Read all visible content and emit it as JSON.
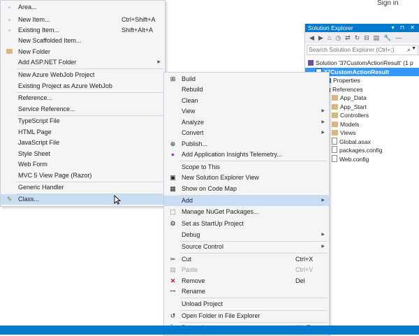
{
  "header": {
    "sign_in": "Sign in"
  },
  "solution_explorer": {
    "title": "Solution Explorer",
    "title_buttons": "▾ ⊓ ✕",
    "search_placeholder": "Search Solution Explorer (Ctrl+;)",
    "solution_label": "Solution '37CustomActionResult' (1 p",
    "project_label": "37CustomActionResult",
    "nodes": [
      "Properties",
      "References",
      "App_Data",
      "App_Start",
      "Controllers",
      "Models",
      "Views",
      "Global.asax",
      "packages.config",
      "Web.config"
    ]
  },
  "add_menu": {
    "items": [
      {
        "label": "Area...",
        "shortcut": ""
      },
      {
        "label": "New Item...",
        "shortcut": "Ctrl+Shift+A"
      },
      {
        "label": "Existing Item...",
        "shortcut": "Shift+Alt+A"
      },
      {
        "label": "New Scaffolded Item...",
        "shortcut": ""
      },
      {
        "label": "New Folder",
        "shortcut": ""
      },
      {
        "label": "Add ASP.NET Folder",
        "shortcut": ""
      },
      {
        "label": "New Azure WebJob Project",
        "shortcut": ""
      },
      {
        "label": "Existing Project as Azure WebJob",
        "shortcut": ""
      },
      {
        "label": "Reference...",
        "shortcut": ""
      },
      {
        "label": "Service Reference...",
        "shortcut": ""
      },
      {
        "label": "TypeScript File",
        "shortcut": ""
      },
      {
        "label": "HTML Page",
        "shortcut": ""
      },
      {
        "label": "JavaScript File",
        "shortcut": ""
      },
      {
        "label": "Style Sheet",
        "shortcut": ""
      },
      {
        "label": "Web Form",
        "shortcut": ""
      },
      {
        "label": "MVC 5 View Page (Razor)",
        "shortcut": ""
      },
      {
        "label": "Generic Handler",
        "shortcut": ""
      },
      {
        "label": "Class...",
        "shortcut": ""
      }
    ]
  },
  "context_menu": {
    "items": [
      {
        "label": "Build",
        "shortcut": ""
      },
      {
        "label": "Rebuild",
        "shortcut": ""
      },
      {
        "label": "Clean",
        "shortcut": ""
      },
      {
        "label": "View",
        "shortcut": ""
      },
      {
        "label": "Analyze",
        "shortcut": ""
      },
      {
        "label": "Convert",
        "shortcut": ""
      },
      {
        "label": "Publish...",
        "shortcut": ""
      },
      {
        "label": "Add Application Insights Telemetry...",
        "shortcut": ""
      },
      {
        "label": "Scope to This",
        "shortcut": ""
      },
      {
        "label": "New Solution Explorer View",
        "shortcut": ""
      },
      {
        "label": "Show on Code Map",
        "shortcut": ""
      },
      {
        "label": "Add",
        "shortcut": ""
      },
      {
        "label": "Manage NuGet Packages...",
        "shortcut": ""
      },
      {
        "label": "Set as StartUp Project",
        "shortcut": ""
      },
      {
        "label": "Debug",
        "shortcut": ""
      },
      {
        "label": "Source Control",
        "shortcut": ""
      },
      {
        "label": "Cut",
        "shortcut": "Ctrl+X"
      },
      {
        "label": "Paste",
        "shortcut": "Ctrl+V"
      },
      {
        "label": "Remove",
        "shortcut": "Del"
      },
      {
        "label": "Rename",
        "shortcut": ""
      },
      {
        "label": "Unload Project",
        "shortcut": ""
      },
      {
        "label": "Open Folder in File Explorer",
        "shortcut": ""
      },
      {
        "label": "Properties",
        "shortcut": "Alt+Enter"
      }
    ]
  },
  "colors": {
    "accent": "#007acc",
    "selection": "#3399ff",
    "menu_highlight": "#c9def5",
    "menu_bg": "#f5f5f5"
  }
}
